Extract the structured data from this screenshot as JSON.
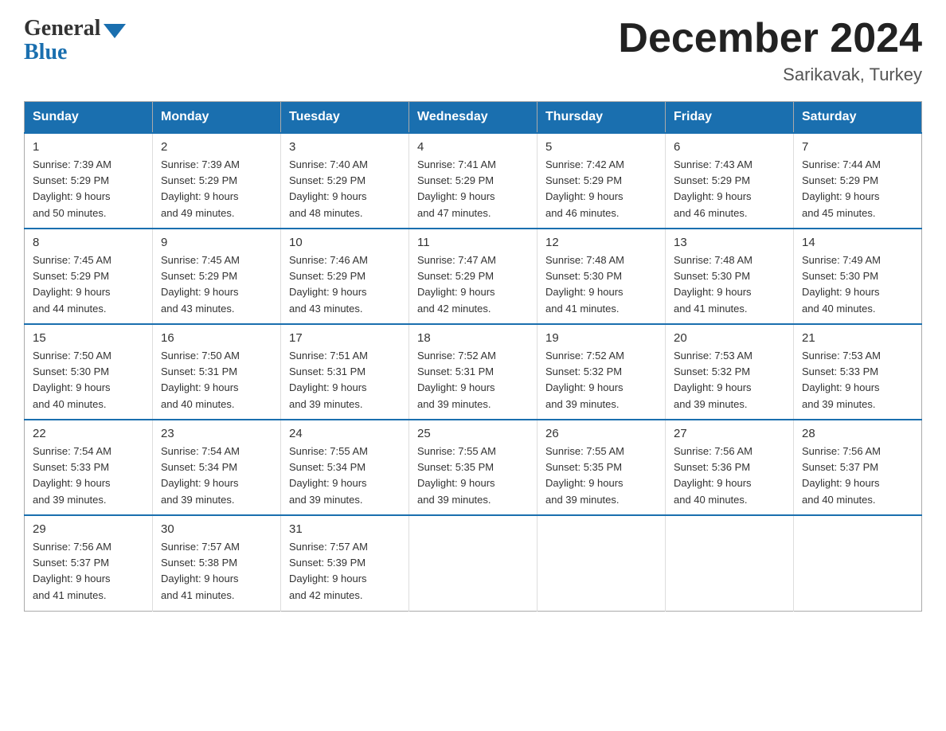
{
  "logo": {
    "general": "General",
    "blue": "Blue"
  },
  "title": "December 2024",
  "subtitle": "Sarikavak, Turkey",
  "days_of_week": [
    "Sunday",
    "Monday",
    "Tuesday",
    "Wednesday",
    "Thursday",
    "Friday",
    "Saturday"
  ],
  "weeks": [
    [
      {
        "day": "1",
        "sunrise": "7:39 AM",
        "sunset": "5:29 PM",
        "daylight": "9 hours and 50 minutes."
      },
      {
        "day": "2",
        "sunrise": "7:39 AM",
        "sunset": "5:29 PM",
        "daylight": "9 hours and 49 minutes."
      },
      {
        "day": "3",
        "sunrise": "7:40 AM",
        "sunset": "5:29 PM",
        "daylight": "9 hours and 48 minutes."
      },
      {
        "day": "4",
        "sunrise": "7:41 AM",
        "sunset": "5:29 PM",
        "daylight": "9 hours and 47 minutes."
      },
      {
        "day": "5",
        "sunrise": "7:42 AM",
        "sunset": "5:29 PM",
        "daylight": "9 hours and 46 minutes."
      },
      {
        "day": "6",
        "sunrise": "7:43 AM",
        "sunset": "5:29 PM",
        "daylight": "9 hours and 46 minutes."
      },
      {
        "day": "7",
        "sunrise": "7:44 AM",
        "sunset": "5:29 PM",
        "daylight": "9 hours and 45 minutes."
      }
    ],
    [
      {
        "day": "8",
        "sunrise": "7:45 AM",
        "sunset": "5:29 PM",
        "daylight": "9 hours and 44 minutes."
      },
      {
        "day": "9",
        "sunrise": "7:45 AM",
        "sunset": "5:29 PM",
        "daylight": "9 hours and 43 minutes."
      },
      {
        "day": "10",
        "sunrise": "7:46 AM",
        "sunset": "5:29 PM",
        "daylight": "9 hours and 43 minutes."
      },
      {
        "day": "11",
        "sunrise": "7:47 AM",
        "sunset": "5:29 PM",
        "daylight": "9 hours and 42 minutes."
      },
      {
        "day": "12",
        "sunrise": "7:48 AM",
        "sunset": "5:30 PM",
        "daylight": "9 hours and 41 minutes."
      },
      {
        "day": "13",
        "sunrise": "7:48 AM",
        "sunset": "5:30 PM",
        "daylight": "9 hours and 41 minutes."
      },
      {
        "day": "14",
        "sunrise": "7:49 AM",
        "sunset": "5:30 PM",
        "daylight": "9 hours and 40 minutes."
      }
    ],
    [
      {
        "day": "15",
        "sunrise": "7:50 AM",
        "sunset": "5:30 PM",
        "daylight": "9 hours and 40 minutes."
      },
      {
        "day": "16",
        "sunrise": "7:50 AM",
        "sunset": "5:31 PM",
        "daylight": "9 hours and 40 minutes."
      },
      {
        "day": "17",
        "sunrise": "7:51 AM",
        "sunset": "5:31 PM",
        "daylight": "9 hours and 39 minutes."
      },
      {
        "day": "18",
        "sunrise": "7:52 AM",
        "sunset": "5:31 PM",
        "daylight": "9 hours and 39 minutes."
      },
      {
        "day": "19",
        "sunrise": "7:52 AM",
        "sunset": "5:32 PM",
        "daylight": "9 hours and 39 minutes."
      },
      {
        "day": "20",
        "sunrise": "7:53 AM",
        "sunset": "5:32 PM",
        "daylight": "9 hours and 39 minutes."
      },
      {
        "day": "21",
        "sunrise": "7:53 AM",
        "sunset": "5:33 PM",
        "daylight": "9 hours and 39 minutes."
      }
    ],
    [
      {
        "day": "22",
        "sunrise": "7:54 AM",
        "sunset": "5:33 PM",
        "daylight": "9 hours and 39 minutes."
      },
      {
        "day": "23",
        "sunrise": "7:54 AM",
        "sunset": "5:34 PM",
        "daylight": "9 hours and 39 minutes."
      },
      {
        "day": "24",
        "sunrise": "7:55 AM",
        "sunset": "5:34 PM",
        "daylight": "9 hours and 39 minutes."
      },
      {
        "day": "25",
        "sunrise": "7:55 AM",
        "sunset": "5:35 PM",
        "daylight": "9 hours and 39 minutes."
      },
      {
        "day": "26",
        "sunrise": "7:55 AM",
        "sunset": "5:35 PM",
        "daylight": "9 hours and 39 minutes."
      },
      {
        "day": "27",
        "sunrise": "7:56 AM",
        "sunset": "5:36 PM",
        "daylight": "9 hours and 40 minutes."
      },
      {
        "day": "28",
        "sunrise": "7:56 AM",
        "sunset": "5:37 PM",
        "daylight": "9 hours and 40 minutes."
      }
    ],
    [
      {
        "day": "29",
        "sunrise": "7:56 AM",
        "sunset": "5:37 PM",
        "daylight": "9 hours and 41 minutes."
      },
      {
        "day": "30",
        "sunrise": "7:57 AM",
        "sunset": "5:38 PM",
        "daylight": "9 hours and 41 minutes."
      },
      {
        "day": "31",
        "sunrise": "7:57 AM",
        "sunset": "5:39 PM",
        "daylight": "9 hours and 42 minutes."
      },
      {
        "day": "",
        "sunrise": "",
        "sunset": "",
        "daylight": ""
      },
      {
        "day": "",
        "sunrise": "",
        "sunset": "",
        "daylight": ""
      },
      {
        "day": "",
        "sunrise": "",
        "sunset": "",
        "daylight": ""
      },
      {
        "day": "",
        "sunrise": "",
        "sunset": "",
        "daylight": ""
      }
    ]
  ],
  "labels": {
    "sunrise": "Sunrise:",
    "sunset": "Sunset:",
    "daylight": "Daylight:"
  }
}
